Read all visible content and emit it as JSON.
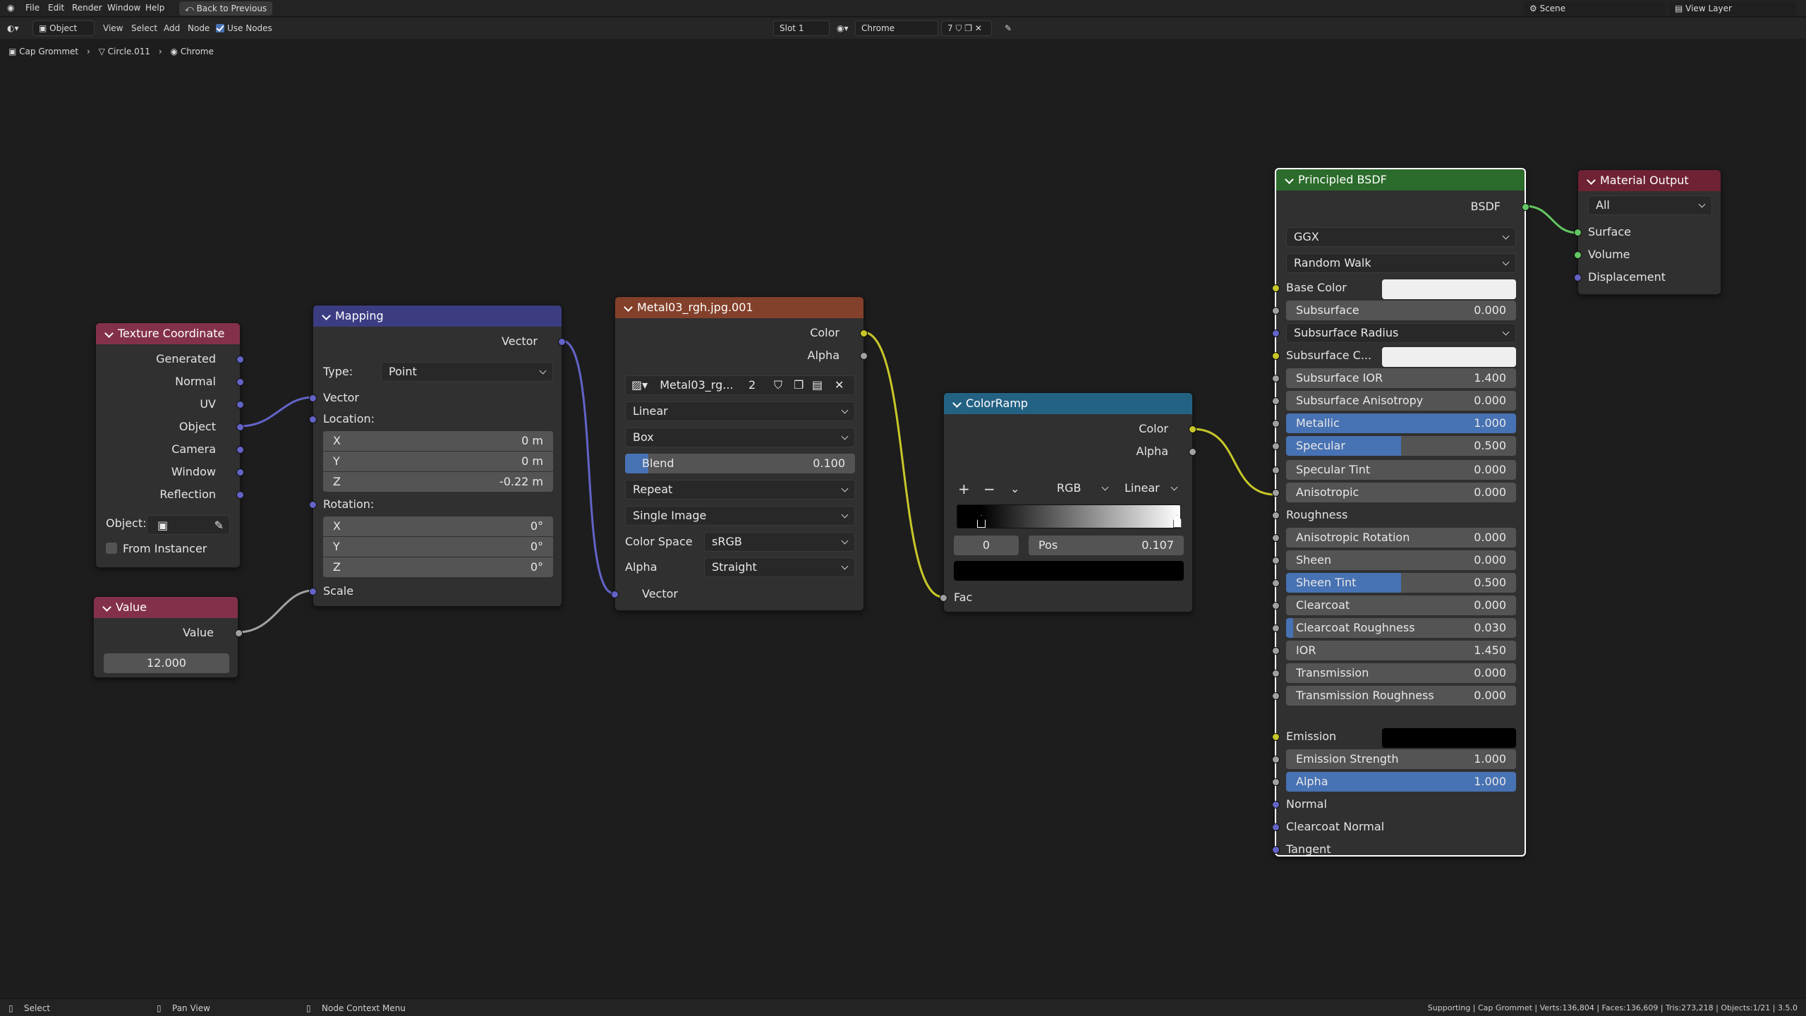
{
  "topbar": {
    "menu": [
      "File",
      "Edit",
      "Render",
      "Window",
      "Help"
    ],
    "back_button": "Back to Previous",
    "scene_label": "Scene",
    "view_layer_label": "View Layer"
  },
  "header": {
    "mode": "Object",
    "menus": [
      "View",
      "Select",
      "Add",
      "Node"
    ],
    "use_nodes_label": "Use Nodes",
    "slot": "Slot 1",
    "material_name": "Chrome",
    "user_count": "7"
  },
  "breadcrumb": {
    "object": "Cap Grommet",
    "mesh": "Circle.011",
    "material": "Chrome"
  },
  "nodes": {
    "texture_coordinate": {
      "title": "Texture Coordinate",
      "outputs": [
        "Generated",
        "Normal",
        "UV",
        "Object",
        "Camera",
        "Window",
        "Reflection"
      ],
      "object_label": "Object:",
      "from_instancer": "From Instancer",
      "color": "#83314a"
    },
    "value": {
      "title": "Value",
      "output": "Value",
      "value": "12.000",
      "color": "#83314a"
    },
    "mapping": {
      "title": "Mapping",
      "output": "Vector",
      "type_label": "Type:",
      "type_value": "Point",
      "vector_input": "Vector",
      "location_label": "Location:",
      "location": [
        {
          "axis": "X",
          "value": "0 m"
        },
        {
          "axis": "Y",
          "value": "0 m"
        },
        {
          "axis": "Z",
          "value": "-0.22 m"
        }
      ],
      "rotation_label": "Rotation:",
      "rotation": [
        {
          "axis": "X",
          "value": "0°"
        },
        {
          "axis": "Y",
          "value": "0°"
        },
        {
          "axis": "Z",
          "value": "0°"
        }
      ],
      "scale_label": "Scale",
      "color": "#3c3c83"
    },
    "image_texture": {
      "title": "Metal03_rgh.jpg.001",
      "outputs": [
        "Color",
        "Alpha"
      ],
      "image_name": "Metal03_rg...",
      "users": "2",
      "interpolation": "Linear",
      "projection": "Box",
      "blend_label": "Blend",
      "blend_value": "0.100",
      "blend_fraction": 0.1,
      "extension": "Repeat",
      "source": "Single Image",
      "color_space_label": "Color Space",
      "color_space": "sRGB",
      "alpha_label": "Alpha",
      "alpha_mode": "Straight",
      "vector_input": "Vector",
      "color": "#83402a"
    },
    "color_ramp": {
      "title": "ColorRamp",
      "outputs": [
        "Color",
        "Alpha"
      ],
      "color_mode": "RGB",
      "interpolation": "Linear",
      "stop_index": "0",
      "pos_label": "Pos",
      "pos_value": "0.107",
      "fac_input": "Fac",
      "color": "#246283"
    },
    "principled": {
      "title": "Principled BSDF",
      "output": "BSDF",
      "distribution": "GGX",
      "subsurface_method": "Random Walk",
      "base_color_label": "Base Color",
      "subsurface_color_label": "Subsurface C...",
      "subsurface_radius_label": "Subsurface Radius",
      "emission_label": "Emission",
      "roughness_label": "Roughness",
      "params": [
        {
          "label": "Subsurface",
          "value": "0.000",
          "fraction": 0.0
        },
        {
          "label": "Subsurface IOR",
          "value": "1.400",
          "fraction": 0.0
        },
        {
          "label": "Subsurface Anisotropy",
          "value": "0.000",
          "fraction": 0.0
        },
        {
          "label": "Metallic",
          "value": "1.000",
          "fraction": 1.0
        },
        {
          "label": "Specular",
          "value": "0.500",
          "fraction": 0.5
        },
        {
          "label": "Specular Tint",
          "value": "0.000",
          "fraction": 0.0
        },
        {
          "label": "Anisotropic",
          "value": "0.000",
          "fraction": 0.0
        },
        {
          "label": "Anisotropic Rotation",
          "value": "0.000",
          "fraction": 0.0
        },
        {
          "label": "Sheen",
          "value": "0.000",
          "fraction": 0.0
        },
        {
          "label": "Sheen Tint",
          "value": "0.500",
          "fraction": 0.5
        },
        {
          "label": "Clearcoat",
          "value": "0.000",
          "fraction": 0.0
        },
        {
          "label": "Clearcoat Roughness",
          "value": "0.030",
          "fraction": 0.03
        },
        {
          "label": "IOR",
          "value": "1.450",
          "fraction": 0.0
        },
        {
          "label": "Transmission",
          "value": "0.000",
          "fraction": 0.0
        },
        {
          "label": "Transmission Roughness",
          "value": "0.000",
          "fraction": 0.0
        },
        {
          "label": "Emission Strength",
          "value": "1.000",
          "fraction": 0.0
        },
        {
          "label": "Alpha",
          "value": "1.000",
          "fraction": 1.0
        }
      ],
      "vector_inputs": [
        "Normal",
        "Clearcoat Normal",
        "Tangent"
      ],
      "color": "#2b6b2b"
    },
    "material_output": {
      "title": "Material Output",
      "target": "All",
      "inputs": [
        "Surface",
        "Volume",
        "Displacement"
      ],
      "color": "#6e2233"
    }
  },
  "status": {
    "select": "Select",
    "pan": "Pan View",
    "context": "Node Context Menu",
    "stats": "Supporting | Cap Grommet | Verts:136,804 | Faces:136,609 | Tris:273,218 | Objects:1/21 | 3.5.0"
  }
}
